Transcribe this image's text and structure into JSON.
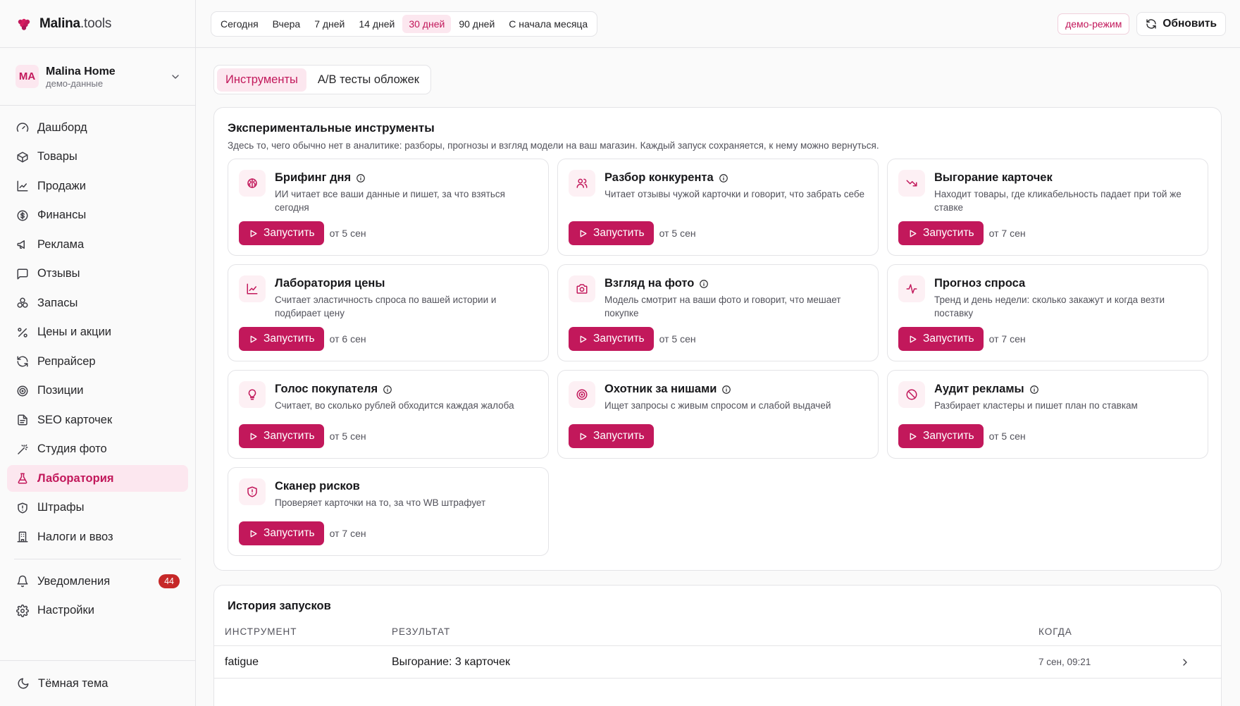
{
  "brand": {
    "name": "Malina",
    "suffix": ".tools"
  },
  "workspace": {
    "initials": "MA",
    "name": "Malina Home",
    "subtitle": "демо-данные"
  },
  "nav": [
    {
      "label": "Дашборд",
      "icon": "gauge-icon"
    },
    {
      "label": "Товары",
      "icon": "box-icon"
    },
    {
      "label": "Продажи",
      "icon": "line-chart-icon"
    },
    {
      "label": "Финансы",
      "icon": "coin-icon"
    },
    {
      "label": "Реклама",
      "icon": "megaphone-icon"
    },
    {
      "label": "Отзывы",
      "icon": "message-icon"
    },
    {
      "label": "Запасы",
      "icon": "boxes-icon"
    },
    {
      "label": "Цены и акции",
      "icon": "percent-icon"
    },
    {
      "label": "Репрайсер",
      "icon": "refresh-icon"
    },
    {
      "label": "Позиции",
      "icon": "target-icon"
    },
    {
      "label": "SEO карточек",
      "icon": "file-text-icon"
    },
    {
      "label": "Студия фото",
      "icon": "wand-icon"
    },
    {
      "label": "Лаборатория",
      "icon": "flask-icon",
      "active": true
    },
    {
      "label": "Штрафы",
      "icon": "shield-icon"
    },
    {
      "label": "Налоги и ввоз",
      "icon": "building-icon"
    }
  ],
  "nav_bottom": {
    "notifications": {
      "label": "Уведомления",
      "count": "44"
    },
    "settings": {
      "label": "Настройки"
    }
  },
  "theme_toggle": "Тёмная тема",
  "periods": [
    "Сегодня",
    "Вчера",
    "7 дней",
    "14 дней",
    "30 дней",
    "90 дней",
    "С начала месяца"
  ],
  "active_period": "30 дней",
  "demo_mode": "демо-режим",
  "refresh_label": "Обновить",
  "tabs": [
    "Инструменты",
    "A/B тесты обложек"
  ],
  "active_tab": "Инструменты",
  "tools_panel": {
    "title": "Экспериментальные инструменты",
    "subtitle": "Здесь то, чего обычно нет в аналитике: разборы, прогнозы и взгляд модели на ваш магазин. Каждый запуск сохраняется, к нему можно вернуться.",
    "run_label": "Запустить",
    "tools": [
      {
        "title": "Брифинг дня",
        "desc": "ИИ читает все ваши данные и пишет, за что взяться сегодня",
        "price": "от 5 сен",
        "info": true,
        "icon": "brain-icon"
      },
      {
        "title": "Разбор конкурента",
        "desc": "Читает отзывы чужой карточки и говорит, что забрать себе",
        "price": "от 5 сен",
        "info": true,
        "icon": "users-icon"
      },
      {
        "title": "Выгорание карточек",
        "desc": "Находит товары, где кликабельность падает при той же ставке",
        "price": "от 7 сен",
        "info": false,
        "icon": "trending-down-icon"
      },
      {
        "title": "Лаборатория цены",
        "desc": "Считает эластичность спроса по вашей истории и подбирает цену",
        "price": "от 6 сен",
        "info": false,
        "icon": "line-chart-icon"
      },
      {
        "title": "Взгляд на фото",
        "desc": "Модель смотрит на ваши фото и говорит, что мешает покупке",
        "price": "от 5 сен",
        "info": true,
        "icon": "camera-icon"
      },
      {
        "title": "Прогноз спроса",
        "desc": "Тренд и день недели: сколько закажут и когда везти поставку",
        "price": "от 7 сен",
        "info": false,
        "icon": "activity-icon"
      },
      {
        "title": "Голос покупателя",
        "desc": "Считает, во сколько рублей обходится каждая жалоба",
        "price": "от 5 сен",
        "info": true,
        "icon": "lightbulb-icon"
      },
      {
        "title": "Охотник за нишами",
        "desc": "Ищет запросы с живым спросом и слабой выдачей",
        "price": "",
        "info": true,
        "icon": "target-icon"
      },
      {
        "title": "Аудит рекламы",
        "desc": "Разбирает кластеры и пишет план по ставкам",
        "price": "от 5 сен",
        "info": true,
        "icon": "ban-icon"
      },
      {
        "title": "Сканер рисков",
        "desc": "Проверяет карточки на то, за что WB штрафует",
        "price": "от 7 сен",
        "info": false,
        "icon": "shield-alert-icon"
      }
    ]
  },
  "history": {
    "title": "История запусков",
    "columns": [
      "ИНСТРУМЕНТ",
      "РЕЗУЛЬТАТ",
      "КОГДА"
    ],
    "rows": [
      {
        "tool": "fatigue",
        "result": "Выгорание: 3 карточек",
        "when": "7 сен, 09:21"
      }
    ]
  },
  "colors": {
    "accent": "#c2185b",
    "accent_soft": "#fce7ef",
    "badge": "#c62828"
  }
}
